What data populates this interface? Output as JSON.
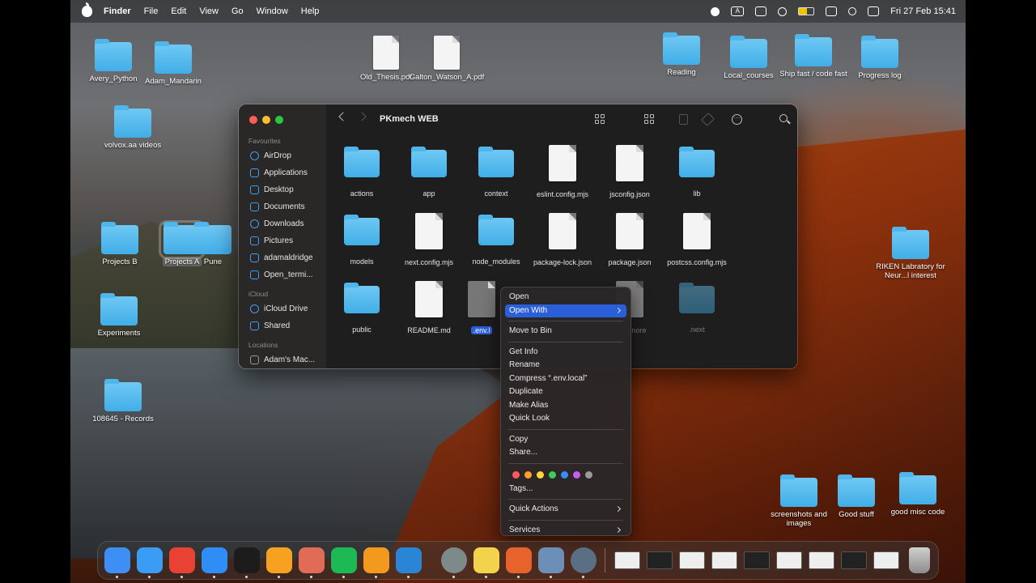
{
  "menubar": {
    "items": [
      "Finder",
      "File",
      "Edit",
      "View",
      "Go",
      "Window",
      "Help"
    ],
    "datetime": "Fri 27 Feb  15:41",
    "input_badge": "A"
  },
  "desktop": {
    "icons": [
      {
        "label": "Avery_Python",
        "kind": "folder"
      },
      {
        "label": "Adam_Mandarin",
        "kind": "folder"
      },
      {
        "label": "volvox.aa videos",
        "kind": "folder"
      },
      {
        "label": "Old_Thesis.pdf",
        "kind": "doc"
      },
      {
        "label": "Galton_Watson_A.pdf",
        "kind": "doc"
      },
      {
        "label": "Reading",
        "kind": "folder"
      },
      {
        "label": "Local_courses",
        "kind": "folder"
      },
      {
        "label": "Ship fast / code fast",
        "kind": "folder"
      },
      {
        "label": "Progress log",
        "kind": "folder"
      },
      {
        "label": "Projects B",
        "kind": "folder"
      },
      {
        "label": "Projects A",
        "kind": "folder"
      },
      {
        "label": "Pune",
        "kind": "folder"
      },
      {
        "label": "Experiments",
        "kind": "folder"
      },
      {
        "label": "108645 - Records",
        "kind": "folder"
      },
      {
        "label": "RIKEN Labratory for Neur...l interest",
        "kind": "folder"
      },
      {
        "label": "screenshots and images",
        "kind": "folder"
      },
      {
        "label": "Good stuff",
        "kind": "folder"
      },
      {
        "label": "good misc code",
        "kind": "folder"
      }
    ]
  },
  "finder": {
    "title": "PKmech WEB",
    "sidebar": {
      "favourites_label": "Favourites",
      "favourites": [
        "AirDrop",
        "Applications",
        "Desktop",
        "Documents",
        "Downloads",
        "Pictures",
        "adamaldridge",
        "Open_termi..."
      ],
      "icloud_label": "iCloud",
      "icloud": [
        "iCloud Drive",
        "Shared"
      ],
      "locations_label": "Locations",
      "locations": [
        "Adam's Mac..."
      ]
    },
    "files": [
      {
        "name": "actions",
        "kind": "folder"
      },
      {
        "name": "app",
        "kind": "folder"
      },
      {
        "name": "context",
        "kind": "folder"
      },
      {
        "name": "eslint.config.mjs",
        "kind": "doc"
      },
      {
        "name": "jsconfig.json",
        "kind": "doc"
      },
      {
        "name": "lib",
        "kind": "folder"
      },
      {
        "name": "models",
        "kind": "folder"
      },
      {
        "name": "next.config.mjs",
        "kind": "doc"
      },
      {
        "name": "node_modules",
        "kind": "folder"
      },
      {
        "name": "package-lock.json",
        "kind": "doc"
      },
      {
        "name": "package.json",
        "kind": "doc"
      },
      {
        "name": "postcss.config.mjs",
        "kind": "doc"
      },
      {
        "name": "public",
        "kind": "folder"
      },
      {
        "name": "README.md",
        "kind": "doc"
      },
      {
        "name": ".env.local",
        "kind": "doc",
        "display": ".env.l"
      },
      {
        "name": ".gitignore",
        "kind": "doc",
        "display": "gnore"
      },
      {
        "name": ".next",
        "kind": "folder"
      }
    ]
  },
  "context_menu": {
    "items": [
      {
        "label": "Open"
      },
      {
        "label": "Open With",
        "submenu": true,
        "highlighted": true
      },
      {
        "sep": true
      },
      {
        "label": "Move to Bin"
      },
      {
        "sep": true
      },
      {
        "label": "Get Info"
      },
      {
        "label": "Rename"
      },
      {
        "label": "Compress “.env.local”"
      },
      {
        "label": "Duplicate"
      },
      {
        "label": "Make Alias"
      },
      {
        "label": "Quick Look"
      },
      {
        "sep": true
      },
      {
        "label": "Copy"
      },
      {
        "label": "Share..."
      },
      {
        "sep": true
      },
      {
        "tags": true
      },
      {
        "label": "Tags..."
      },
      {
        "sep": true
      },
      {
        "label": "Quick Actions",
        "submenu": true
      },
      {
        "sep": true
      },
      {
        "label": "Services",
        "submenu": true
      }
    ],
    "tag_colors": [
      "#ff5a5a",
      "#ff9f2e",
      "#ffd53a",
      "#37d158",
      "#3a8df7",
      "#c45ff0",
      "#9a9a9a"
    ]
  },
  "dock": {
    "apps": [
      {
        "name": "finder-icon",
        "color": "#3d8ff5"
      },
      {
        "name": "safari-icon",
        "color": "#3a9cf4"
      },
      {
        "name": "chrome-icon",
        "color": "#e94235"
      },
      {
        "name": "app-store-icon",
        "color": "#2f8ef5"
      },
      {
        "name": "terminal-icon",
        "color": "#1c1c1c"
      },
      {
        "name": "pages-icon",
        "color": "#f7a120"
      },
      {
        "name": "launchpad-icon",
        "color": "#e06b57"
      },
      {
        "name": "spotify-icon",
        "color": "#1db954"
      },
      {
        "name": "sublime-icon",
        "color": "#f39a1e"
      },
      {
        "name": "vscode-icon",
        "color": "#2a85d6"
      },
      {
        "name": "tex-icon",
        "color": "#7d8a8a"
      },
      {
        "name": "notes-icon",
        "color": "#f2d34b"
      },
      {
        "name": "firefox-icon",
        "color": "#e8632c"
      },
      {
        "name": "preview-icon",
        "color": "#6c8fb8"
      },
      {
        "name": "quicktime-icon",
        "color": "#5a6f84"
      }
    ]
  }
}
